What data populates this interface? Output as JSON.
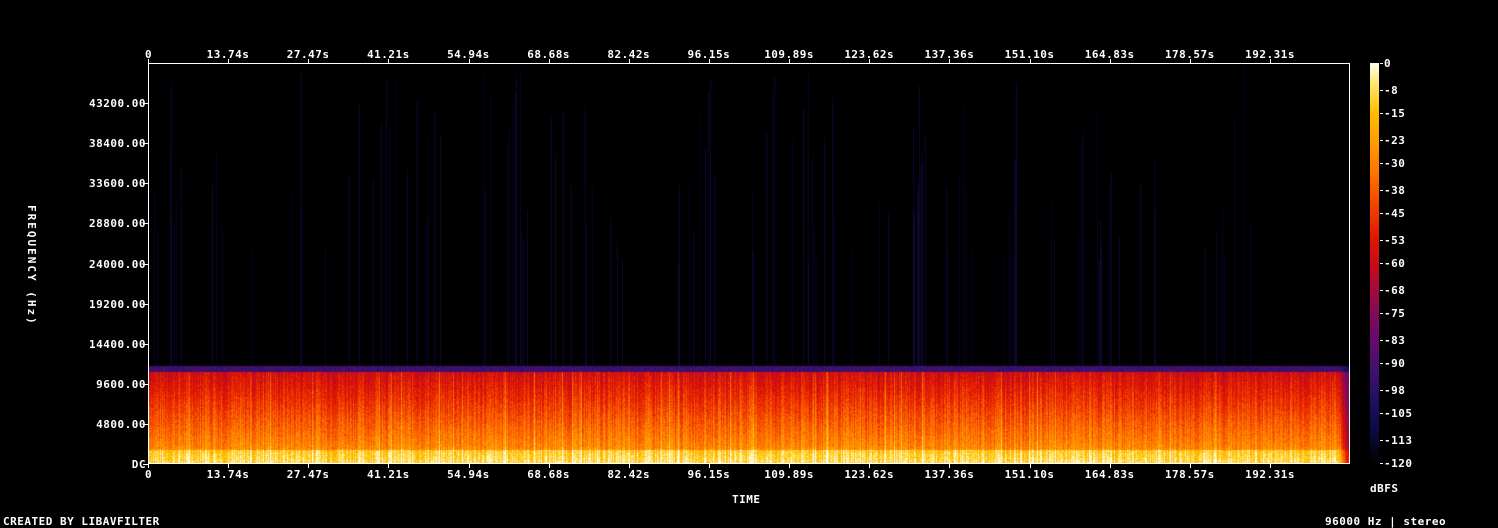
{
  "time_ticks": [
    "0",
    "13.74s",
    "27.47s",
    "41.21s",
    "54.94s",
    "68.68s",
    "82.42s",
    "96.15s",
    "109.89s",
    "123.62s",
    "137.36s",
    "151.10s",
    "164.83s",
    "178.57s",
    "192.31s"
  ],
  "freq_ticks": [
    "DC",
    "4800.00",
    "9600.00",
    "14400.00",
    "19200.00",
    "24000.00",
    "28800.00",
    "33600.00",
    "38400.00",
    "43200.00"
  ],
  "db_ticks": [
    "0",
    "-8",
    "-15",
    "-23",
    "-30",
    "-38",
    "-45",
    "-53",
    "-60",
    "-68",
    "-75",
    "-83",
    "-90",
    "-98",
    "-105",
    "-113",
    "-120"
  ],
  "labels": {
    "xlabel": "TIME",
    "ylabel": "FREQUENCY (Hz)",
    "colorbar_label": "dBFS",
    "credit": "CREATED BY LIBAVFILTER",
    "info": "96000 Hz | stereo"
  },
  "chart_data": {
    "type": "heatmap",
    "title": "",
    "xlabel": "TIME",
    "ylabel": "FREQUENCY (Hz)",
    "colorbar_label": "dBFS",
    "x_unit": "s",
    "x_range": [
      0,
      206
    ],
    "y_range": [
      0,
      48000
    ],
    "z_range": [
      -120,
      0
    ],
    "x_tick_values": [
      0,
      13.74,
      27.47,
      41.21,
      54.94,
      68.68,
      82.42,
      96.15,
      109.89,
      123.62,
      137.36,
      151.1,
      164.83,
      178.57,
      192.31
    ],
    "y_tick_values": [
      0,
      4800,
      9600,
      14400,
      19200,
      24000,
      28800,
      33600,
      38400,
      43200
    ],
    "z_tick_values": [
      0,
      -8,
      -15,
      -23,
      -30,
      -38,
      -45,
      -53,
      -60,
      -68,
      -75,
      -83,
      -90,
      -98,
      -105,
      -113,
      -120
    ],
    "content_cutoff_hz": 11000,
    "sample_rate_hz": 96000,
    "channels": "stereo",
    "colors": {
      "low": "#000000",
      "mid": "#d01000",
      "high": "#ffffe0"
    }
  }
}
